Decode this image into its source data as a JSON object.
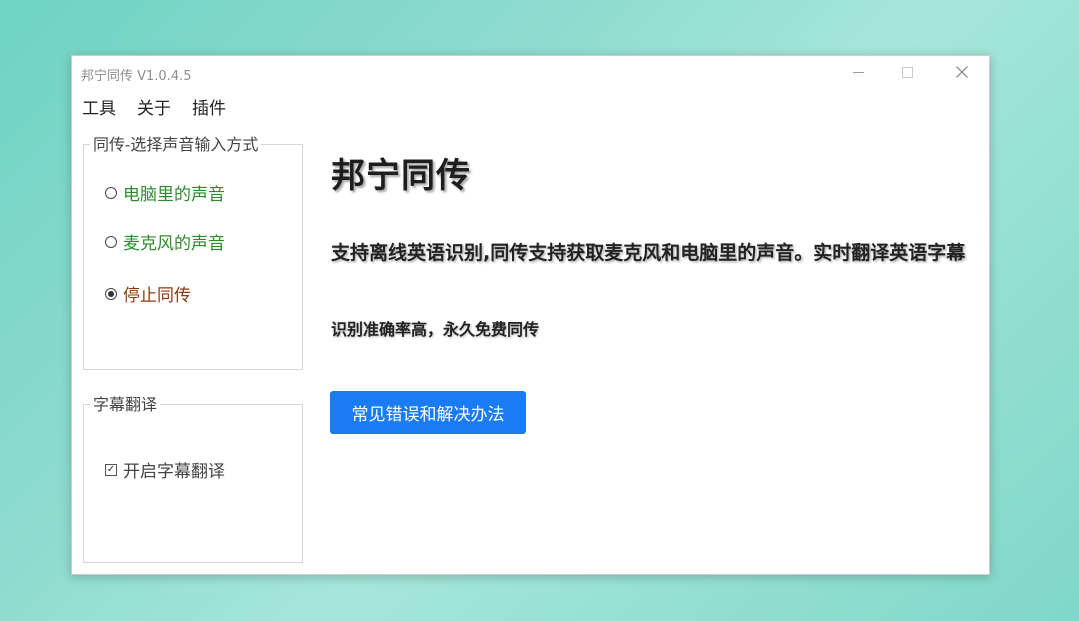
{
  "window": {
    "title": "邦宁同传 V1.0.4.5",
    "controls": {
      "minimize": "minimize-icon",
      "maximize": "maximize-icon",
      "close": "close-icon"
    }
  },
  "menu": {
    "items": [
      {
        "label": "工具"
      },
      {
        "label": "关于"
      },
      {
        "label": "插件"
      }
    ]
  },
  "input_group": {
    "legend": "同传-选择声音输入方式",
    "options": [
      {
        "label": "电脑里的声音",
        "checked": false,
        "color": "#2e8b2e"
      },
      {
        "label": "麦克风的声音",
        "checked": false,
        "color": "#2e8b2e"
      },
      {
        "label": "停止同传",
        "checked": true,
        "color": "#8b3a0e"
      }
    ]
  },
  "subtitle_group": {
    "legend": "字幕翻译",
    "checkbox": {
      "label": "开启字幕翻译",
      "checked": true
    }
  },
  "main": {
    "heading": "邦宁同传",
    "description": "支持离线英语识别,同传支持获取麦克风和电脑里的声音。实时翻译英语字幕",
    "subtext": "识别准确率高，永久免费同传",
    "help_button": "常见错误和解决办法",
    "accent_color": "#1a7cf5"
  }
}
